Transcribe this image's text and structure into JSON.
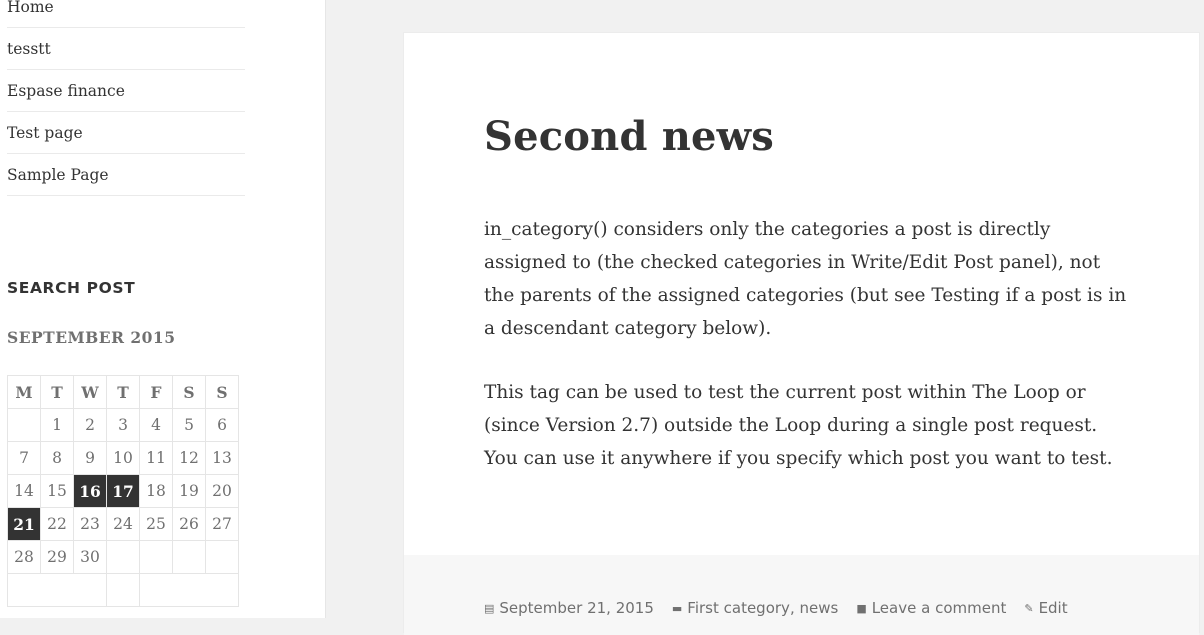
{
  "nav": {
    "items": [
      {
        "label": "Home"
      },
      {
        "label": "tesstt"
      },
      {
        "label": "Espase finance"
      },
      {
        "label": "Test page"
      },
      {
        "label": "Sample Page"
      }
    ]
  },
  "widget": {
    "title": "SEARCH POST"
  },
  "calendar": {
    "caption": "SEPTEMBER 2015",
    "days": [
      "M",
      "T",
      "W",
      "T",
      "F",
      "S",
      "S"
    ],
    "rows": [
      [
        "",
        "1",
        "2",
        "3",
        "4",
        "5",
        "6"
      ],
      [
        "7",
        "8",
        "9",
        "10",
        "11",
        "12",
        "13"
      ],
      [
        "14",
        "15",
        "16",
        "17",
        "18",
        "19",
        "20"
      ],
      [
        "21",
        "22",
        "23",
        "24",
        "25",
        "26",
        "27"
      ],
      [
        "28",
        "29",
        "30",
        "",
        "",
        "",
        ""
      ]
    ],
    "highlighted": [
      "16",
      "17",
      "21"
    ]
  },
  "post": {
    "title": "Second news",
    "paragraphs": [
      "in_category() considers only the categories a post is directly assigned to (the checked categories in Write/Edit Post panel), not the parents of the assigned categories (but see Testing if a post is in a descendant category below).",
      "This tag can be used to test the current post within The Loop or (since Version 2.7) outside the Loop during a single post request. You can use it anywhere if you specify which post you want to test."
    ],
    "meta": {
      "date": "September 21, 2015",
      "categories": [
        "First category",
        "news"
      ],
      "comments": "Leave a comment",
      "edit": "Edit"
    }
  },
  "icons": {
    "date": "calendar-icon",
    "category": "folder-icon",
    "comment": "comment-icon",
    "edit": "pencil-icon"
  }
}
